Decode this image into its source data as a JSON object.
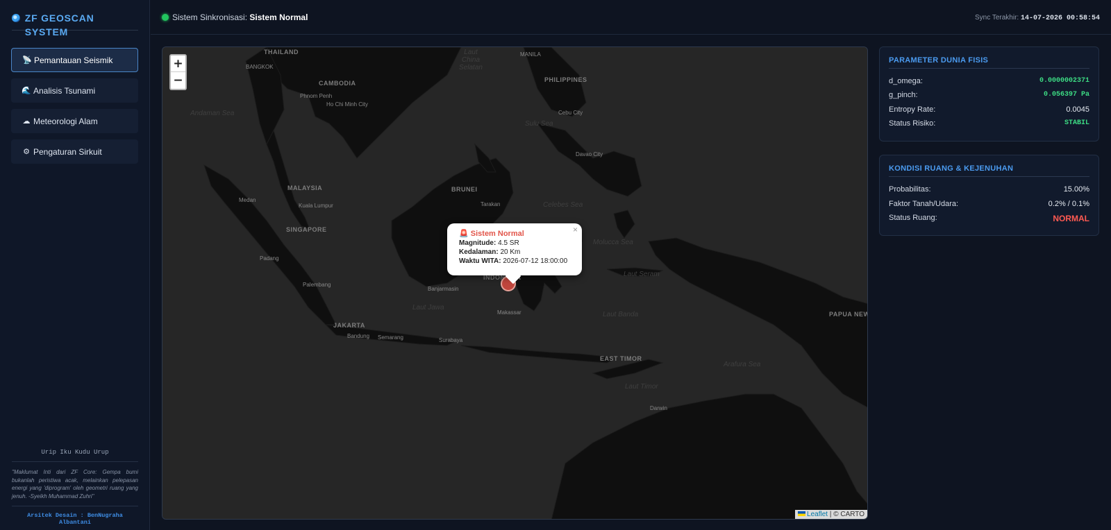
{
  "sidebar": {
    "brand": "ZF GEOSCAN SYSTEM",
    "items": [
      {
        "label": "Pemantauan Seismik",
        "icon": "satellite-dish-icon",
        "glyph": "📡"
      },
      {
        "label": "Analisis Tsunami",
        "icon": "wave-icon",
        "glyph": "🌊"
      },
      {
        "label": "Meteorologi Alam",
        "icon": "cloud-icon",
        "glyph": "☁"
      },
      {
        "label": "Pengaturan Sirkuit",
        "icon": "gear-icon",
        "glyph": "⚙"
      }
    ],
    "motto": "Urip Iku Kudu Urup",
    "quote": "\"Maklumat Inti dari ZF Core: Gempa bumi bukanlah peristiwa acak, melainkan pelepasan energi yang 'diprogram' oleh geometri ruang yang jenuh. -Syeikh Muhammad Zuhri\"",
    "architect": "Arsitek Desain : BenNugraha Albantani"
  },
  "header": {
    "sync_label": "Sistem Sinkronisasi:",
    "sync_value": "Sistem Normal",
    "last_sync_label": "Sync Terakhir:",
    "last_sync_value": "14-07-2026 00:58:54"
  },
  "map": {
    "zoom_in": "+",
    "zoom_out": "−",
    "attribution_leaflet": "Leaflet",
    "attribution_rest": "| © CARTO",
    "labels": {
      "thailand": "THAILAND",
      "bangkok": "BANGKOK",
      "cambodia": "CAMBODIA",
      "phnom_penh": "Phnom Penh",
      "hcmc": "Ho Chi Minh City",
      "andaman": "Andaman Sea",
      "south_china": "Laut China Selatan",
      "manila": "MANILA",
      "philippines": "PHILIPPINES",
      "sulu": "Sulu Sea",
      "cebu": "Cebu City",
      "davao": "Davao City",
      "malaysia": "MALAYSIA",
      "medan": "Medan",
      "kuala_lumpur": "Kuala Lumpur",
      "brunei": "BRUNEI",
      "tarakan": "Tarakan",
      "celebes": "Celebes Sea",
      "singapore": "SINGAPORE",
      "padang": "Padang",
      "palembang": "Palembang",
      "banjarmasin": "Banjarmasin",
      "indonesia": "INDONESIA",
      "molucca": "Molucca Sea",
      "seram": "Laut Seram",
      "jawa": "Laut Jawa",
      "makassar": "Makassar",
      "banda": "Laut Banda",
      "jakarta": "JAKARTA",
      "bandung": "Bandung",
      "semarang": "Semarang",
      "surabaya": "Surabaya",
      "east_timor": "EAST TIMOR",
      "arafura": "Arafura Sea",
      "timor": "Laut Timor",
      "darwin": "Darwin",
      "papua": "PAPUA NEW GUINEA"
    },
    "popup": {
      "title": "Sistem Normal",
      "magnitude_label": "Magnitude:",
      "magnitude_value": "4.5 SR",
      "depth_label": "Kedalaman:",
      "depth_value": "20 Km",
      "time_label": "Waktu WITA:",
      "time_value": "2026-07-12 18:00:00",
      "close": "×"
    }
  },
  "panels": {
    "physics": {
      "title": "PARAMETER DUNIA FISIS",
      "rows": [
        {
          "key": "d_omega:",
          "value": "0.0000002371"
        },
        {
          "key": "g_pinch:",
          "value": "0.056397 Pa"
        },
        {
          "key": "Entropy Rate:",
          "value": "0.0045"
        },
        {
          "key": "Status Risiko:",
          "value": "STABIL"
        }
      ]
    },
    "space": {
      "title": "KONDISI RUANG & KEJENUHAN",
      "rows": [
        {
          "key": "Probabilitas:",
          "value": "15.00%"
        },
        {
          "key": "Faktor Tanah/Udara:",
          "value": "0.2% / 0.1%"
        },
        {
          "key": "Status Ruang:",
          "value": "NORMAL"
        }
      ]
    }
  },
  "colors": {
    "accent": "#4b9bf0",
    "ok": "#22c55e",
    "alert": "#ff5a52",
    "marker": "#c0463d"
  }
}
